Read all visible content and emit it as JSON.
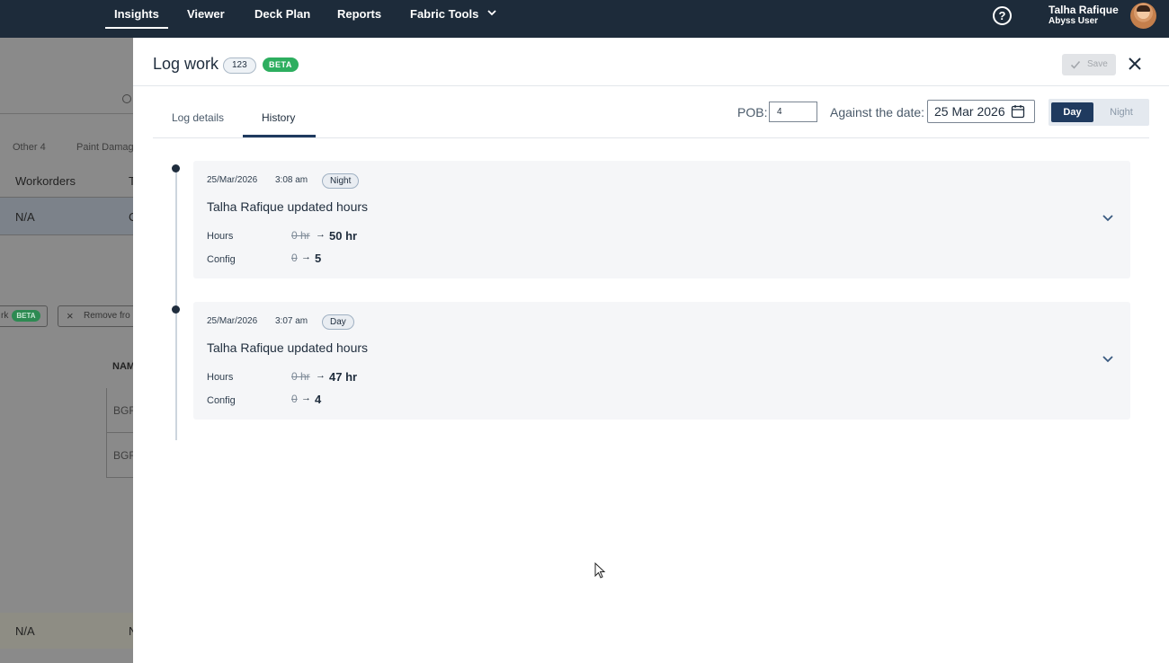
{
  "nav": {
    "items": [
      "Insights",
      "Viewer",
      "Deck Plan",
      "Reports",
      "Fabric Tools"
    ],
    "active": "Insights",
    "user_name": "Talha Rafique",
    "user_role": "Abyss User",
    "help_glyph": "?"
  },
  "background": {
    "filters": [
      "Other 4",
      "Paint Damag"
    ],
    "column_headers": [
      "Workorders",
      "T"
    ],
    "row_values": [
      "N/A",
      "C"
    ],
    "action_label": "rk",
    "action_badge": "BETA",
    "remove_label": "Remove fro",
    "name_header": "NAM",
    "cells": [
      "BGF",
      "BGF"
    ],
    "bottom_row": [
      "N/A",
      "N"
    ]
  },
  "drawer": {
    "title": "Log work",
    "count_badge": "123",
    "beta_badge": "BETA",
    "save_label": "Save",
    "tabs": [
      "Log details",
      "History"
    ],
    "active_tab": "History",
    "pob_label": "POB:",
    "pob_value": "4",
    "date_label": "Against the date:",
    "date_value": "25 Mar 2026",
    "shift_options": [
      "Day",
      "Night"
    ],
    "shift_selected": "Day"
  },
  "history": [
    {
      "date": "25/Mar/2026",
      "time": "3:08 am",
      "shift": "Night",
      "title": "Talha Rafique updated hours",
      "changes": [
        {
          "label": "Hours",
          "old": "0 hr",
          "arrow": "→",
          "new": "50 hr"
        },
        {
          "label": "Config",
          "old": "0",
          "arrow": "→",
          "new": "5"
        }
      ]
    },
    {
      "date": "25/Mar/2026",
      "time": "3:07 am",
      "shift": "Day",
      "title": "Talha Rafique updated hours",
      "changes": [
        {
          "label": "Hours",
          "old": "0 hr",
          "arrow": "→",
          "new": "47 hr"
        },
        {
          "label": "Config",
          "old": "0",
          "arrow": "→",
          "new": "4"
        }
      ]
    }
  ],
  "colors": {
    "nav_bg": "#1d2b3a",
    "accent": "#1f3a5f",
    "beta_green": "#2dae5f"
  },
  "icons": [
    "chevron-down-icon",
    "help-icon",
    "avatar",
    "check-icon",
    "close-icon",
    "calendar-icon",
    "search-icon",
    "cursor-icon"
  ]
}
